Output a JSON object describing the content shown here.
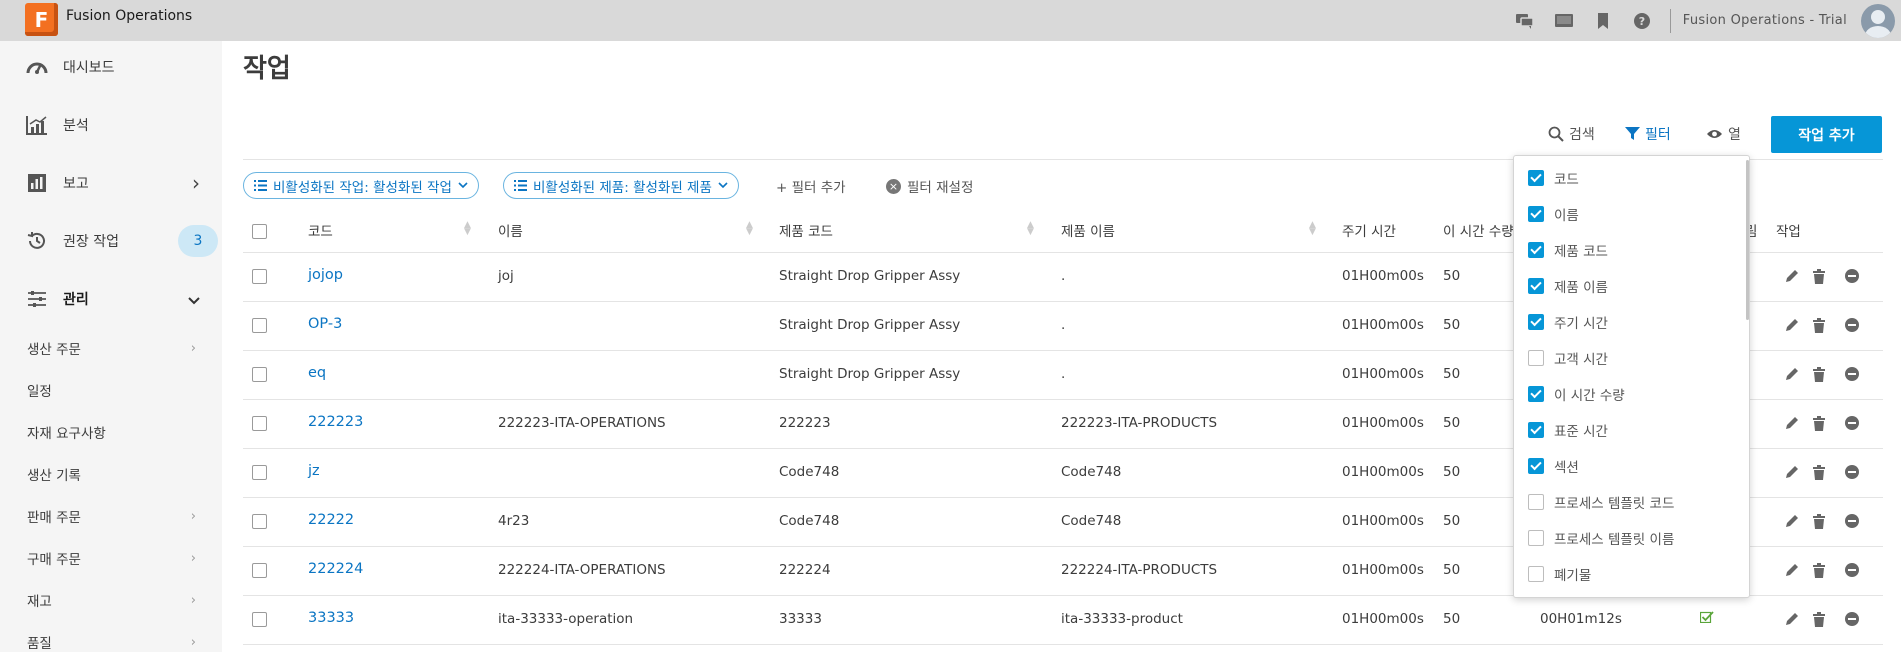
{
  "app": {
    "logo_letter": "F",
    "name": "Fusion Operations",
    "account": "Fusion Operations - Trial"
  },
  "top_icons": [
    "chat-icon",
    "screen-icon",
    "bookmark-icon",
    "help-icon"
  ],
  "sidebar": {
    "items": [
      {
        "label": "대시보드",
        "icon": "dashboard-icon"
      },
      {
        "label": "분석",
        "icon": "analytics-icon"
      },
      {
        "label": "보고",
        "icon": "report-icon",
        "chevron": "›"
      },
      {
        "label": "권장 작업",
        "icon": "history-icon",
        "badge": "3"
      },
      {
        "label": "관리",
        "icon": "sliders-icon",
        "chevron": "⌄"
      }
    ],
    "sub_items": [
      {
        "label": "생산 주문",
        "chevron": "›"
      },
      {
        "label": "일정"
      },
      {
        "label": "자재 요구사항"
      },
      {
        "label": "생산 기록"
      },
      {
        "label": "판매 주문",
        "chevron": "›"
      },
      {
        "label": "구매 주문",
        "chevron": "›"
      },
      {
        "label": "재고",
        "chevron": "›"
      },
      {
        "label": "품질",
        "chevron": "›"
      }
    ]
  },
  "page": {
    "title": "작업"
  },
  "toolbar": {
    "search": "검색",
    "filter": "필터",
    "columns": "열",
    "add": "작업 추가"
  },
  "filters": {
    "chips": [
      "비활성화된 작업: 활성화된 작업",
      "비활성화된 제품: 활성화된 제품"
    ],
    "add_filter": "+ 필터 추가",
    "reset": "필터 재설정"
  },
  "table": {
    "headers": {
      "code": "코드",
      "name": "이름",
      "product_code": "제품 코드",
      "product_name": "제품 이름",
      "cycle_time": "주기 시간",
      "qty": "이 시간 수량",
      "hidden_tail": "림",
      "actions": "작업"
    },
    "rows": [
      {
        "code": "jojop",
        "name": "joj",
        "product_code": "Straight Drop Gripper Assy",
        "product_name": ".",
        "cycle_time": "01H00m00s",
        "qty": "50",
        "std": "",
        "ok": false
      },
      {
        "code": "OP-3",
        "name": "",
        "product_code": "Straight Drop Gripper Assy",
        "product_name": ".",
        "cycle_time": "01H00m00s",
        "qty": "50",
        "std": "",
        "ok": false
      },
      {
        "code": "eq",
        "name": "",
        "product_code": "Straight Drop Gripper Assy",
        "product_name": ".",
        "cycle_time": "01H00m00s",
        "qty": "50",
        "std": "",
        "ok": false
      },
      {
        "code": "222223",
        "name": "222223-ITA-OPERATIONS",
        "product_code": "222223",
        "product_name": "222223-ITA-PRODUCTS",
        "cycle_time": "01H00m00s",
        "qty": "50",
        "std": "",
        "ok": false
      },
      {
        "code": "jz",
        "name": "",
        "product_code": "Code748",
        "product_name": "Code748",
        "cycle_time": "01H00m00s",
        "qty": "50",
        "std": "",
        "ok": false
      },
      {
        "code": "22222",
        "name": "4r23",
        "product_code": "Code748",
        "product_name": "Code748",
        "cycle_time": "01H00m00s",
        "qty": "50",
        "std": "",
        "ok": false
      },
      {
        "code": "222224",
        "name": "222224-ITA-OPERATIONS",
        "product_code": "222224",
        "product_name": "222224-ITA-PRODUCTS",
        "cycle_time": "01H00m00s",
        "qty": "50",
        "std": "",
        "ok": false
      },
      {
        "code": "33333",
        "name": "ita-33333-operation",
        "product_code": "33333",
        "product_name": "ita-33333-product",
        "cycle_time": "01H00m00s",
        "qty": "50",
        "std": "00H01m12s",
        "ok": true
      }
    ]
  },
  "column_panel": {
    "options": [
      {
        "label": "코드",
        "checked": true
      },
      {
        "label": "이름",
        "checked": true
      },
      {
        "label": "제품 코드",
        "checked": true
      },
      {
        "label": "제품 이름",
        "checked": true
      },
      {
        "label": "주기 시간",
        "checked": true
      },
      {
        "label": "고객 시간",
        "checked": false
      },
      {
        "label": "이 시간 수량",
        "checked": true
      },
      {
        "label": "표준 시간",
        "checked": true
      },
      {
        "label": "섹션",
        "checked": true
      },
      {
        "label": "프로세스 템플릿 코드",
        "checked": false
      },
      {
        "label": "프로세스 템플릿 이름",
        "checked": false
      },
      {
        "label": "폐기물",
        "checked": false
      }
    ]
  },
  "colors": {
    "accent": "#0696d7",
    "link": "#0b75c3",
    "brand": "#f37021",
    "sidebar_bg": "#f5f5f5",
    "topbar_bg": "#d9d9d9"
  }
}
